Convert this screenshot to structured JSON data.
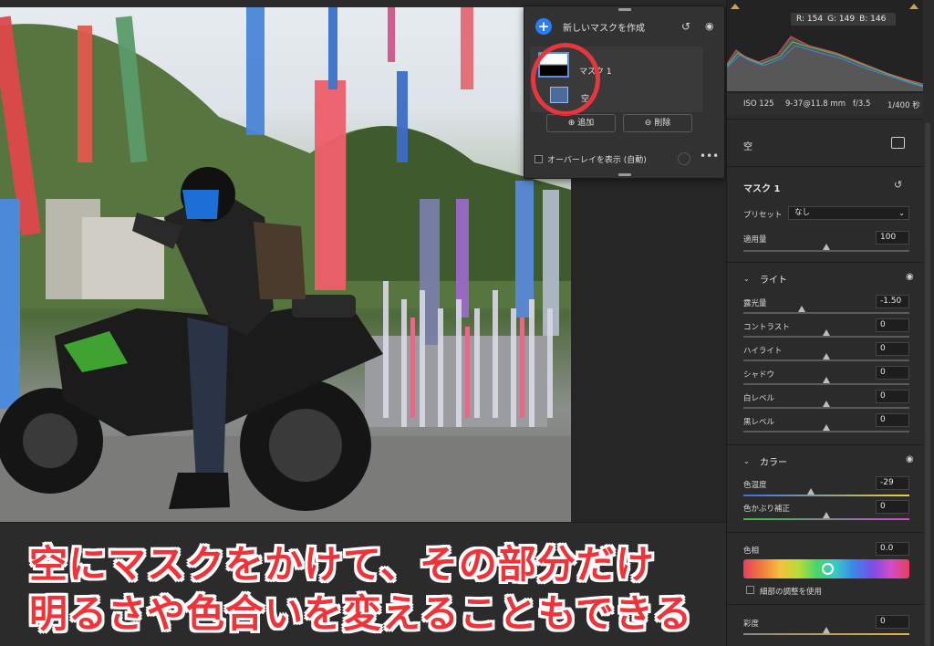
{
  "mask_panel": {
    "new_mask_label": "新しいマスクを作成",
    "mask_name": "マスク 1",
    "sub_mask_name": "空",
    "add_label": "追加",
    "delete_label": "削除",
    "overlay_label": "オーバーレイを表示 (自動)"
  },
  "histogram": {
    "r": "R: 154",
    "g": "G: 149",
    "b": "B: 146"
  },
  "exif": {
    "iso": "ISO 125",
    "focal": "9-37@11.8 mm",
    "aperture": "f/3.5",
    "shutter": "1/400 秒"
  },
  "panel": {
    "sky_title": "空",
    "mask_title": "マスク 1",
    "preset_label": "プリセット",
    "preset_value": "なし",
    "amount_label": "適用量",
    "amount_value": "100",
    "light_title": "ライト",
    "light_rows": [
      {
        "label": "露光量",
        "value": "-1.50",
        "level": 0.35
      },
      {
        "label": "コントラスト",
        "value": "0",
        "level": 0.5
      },
      {
        "label": "ハイライト",
        "value": "0",
        "level": 0.5
      },
      {
        "label": "シャドウ",
        "value": "0",
        "level": 0.5
      },
      {
        "label": "白レベル",
        "value": "0",
        "level": 0.5
      },
      {
        "label": "黒レベル",
        "value": "0",
        "level": 0.5
      }
    ],
    "color_title": "カラー",
    "temp_label": "色温度",
    "temp_value": "-29",
    "tint_label": "色かぶり補正",
    "tint_value": "0",
    "hue_label": "色相",
    "hue_value": "0.0",
    "fine_label": "細部の調整を使用",
    "sat_label": "彩度",
    "sat_value": "0"
  },
  "caption": {
    "line1": "空にマスクをかけて、その部分だけ",
    "line2": "明るさや色合いを変えることもできる"
  },
  "colors": {
    "accent": "#2a7cf6",
    "highlight_circle": "#e8363e",
    "caption_text": "#ef3338"
  }
}
